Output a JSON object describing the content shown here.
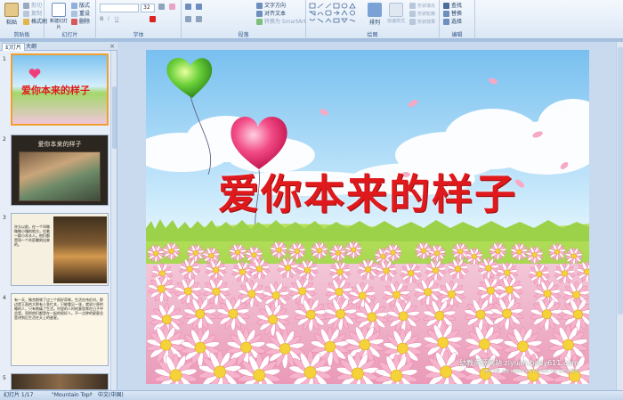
{
  "ribbon": {
    "clipboard": {
      "group_label": "剪贴板",
      "paste": "粘贴",
      "cut": "剪切",
      "copy": "复制",
      "format_painter": "格式刷"
    },
    "slides": {
      "group_label": "幻灯片",
      "new_slide": "新建幻灯片",
      "layout": "版式",
      "reset": "重设",
      "delete": "删除"
    },
    "font": {
      "group_label": "字体",
      "size_value": "32"
    },
    "paragraph": {
      "group_label": "段落",
      "text_direction": "文字方向",
      "align_text": "对齐文本",
      "smartart": "转换为 SmartArt"
    },
    "drawing": {
      "group_label": "绘图",
      "arrange": "排列",
      "quick_styles": "快速样式",
      "shape_fill": "形状填充",
      "shape_outline": "形状轮廓",
      "shape_effects": "形状效果"
    },
    "editing": {
      "group_label": "编辑",
      "find": "查找",
      "replace": "替换",
      "select": "选择"
    }
  },
  "pane": {
    "tab_slides": "幻灯片",
    "tab_outline": "大纲",
    "close": "×",
    "thumbs": [
      {
        "num": "1",
        "title": "爱你本来的样子"
      },
      {
        "num": "2",
        "title": "爱你本来的样子"
      },
      {
        "num": "3",
        "text": "许久以前，在一个叫做微微小镇的地方，住着一群小木头人。他们都是同一个木匠雕刻出来的。"
      },
      {
        "num": "4",
        "text": "有一天，微克斯顿了过三个很好奇咪，生活在伟伦村，那边是王面的大那有人急忙关，只能看见一张，就说少原的睡的人，只有刺痛了生活。村里的人时的意思常在日子中总是，而把他们都是在一起的很好人。不一点钟的星星总是讲到后生活在天上的星星。"
      },
      {
        "num": "5"
      }
    ]
  },
  "slide": {
    "title": "爱你本来的样子",
    "watermark_main": "幼教资源网站  ziyuan.baby611.com",
    "watermark_sub": "课件下载  儿歌  故事MP3  FLASH课件下载  试卷下载等"
  },
  "status": {
    "slide_counter": "幻灯片 1/17",
    "theme": "\"Mountain Top\"",
    "language": "中文(中国)"
  },
  "colors": {
    "title_red": "#e0191c",
    "accent_orange": "#f0a030",
    "ribbon_blue": "#dbe7f5"
  }
}
